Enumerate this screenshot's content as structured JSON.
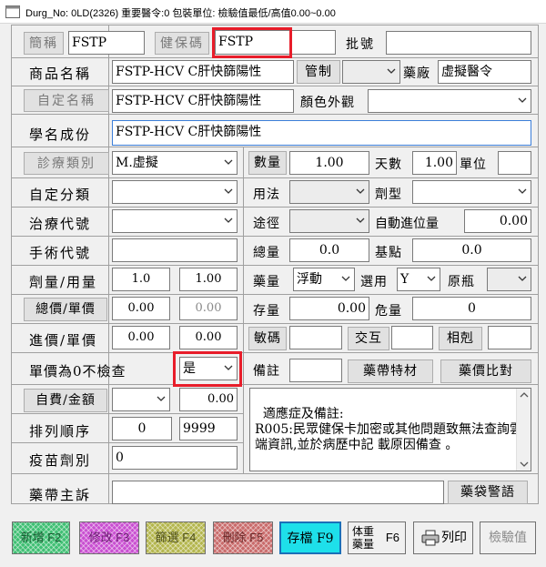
{
  "window": {
    "title": "Durg_No: 0LD(2326) 重要醫令:0 包裝單位: 檢驗值最低/高值0.00~0.00"
  },
  "fields": {
    "short_name_label": "簡稱",
    "short_name": "FSTP",
    "nhi_code_label": "健保碼",
    "nhi_code": "FSTP",
    "batch_label": "批號",
    "batch": "",
    "product_name_label": "商品名稱",
    "product_name": "FSTP-HCV C肝快篩陽性",
    "control_label": "管制",
    "control": "",
    "manufacturer_label": "藥廠",
    "manufacturer": "虛擬醫令",
    "custom_name_label": "自定名稱",
    "custom_name": "FSTP-HCV C肝快篩陽性",
    "appearance_label": "顏色外觀",
    "appearance": "",
    "generic_label": "學名成份",
    "generic": "FSTP-HCV C肝快篩陽性",
    "category_label": "診療類別",
    "category": "M.虛擬",
    "qty_label": "數量",
    "qty": "1.00",
    "days_label": "天數",
    "days": "1.00",
    "unit_label": "單位",
    "unit": "",
    "custom_class_label": "自定分類",
    "custom_class": "",
    "usage_label": "用法",
    "usage": "",
    "dosage_form_label": "劑型",
    "dosage_form": "",
    "treatment_code_label": "治療代號",
    "treatment_code": "",
    "route_label": "途徑",
    "route": "",
    "auto_round_label": "自動進位量",
    "auto_round": "0.00",
    "surgery_code_label": "手術代號",
    "surgery_code": "",
    "total_qty_label": "總量",
    "total_qty": "0.0",
    "base_point_label": "基點",
    "base_point": "0.0",
    "dose_label": "劑量/用量",
    "dose": "1.0",
    "dose2": "1.00",
    "bag_label": "藥量",
    "bag_type": "浮動",
    "option_label": "選用",
    "option": "Y",
    "original_label": "原瓶",
    "original": "",
    "price_label": "總價/單價",
    "total_price": "0.00",
    "unit_price": "0.00",
    "stock_label": "存量",
    "stock": "0.00",
    "danger_label": "危量",
    "danger": "0",
    "purchase_label": "進價/單價",
    "purchase_total": "0.00",
    "purchase_unit": "0.00",
    "allergy_label": "敏碼",
    "allergy": "",
    "interact_label": "交互",
    "interact": "",
    "conflict_label": "相剋",
    "conflict": "",
    "zero_check_label": "單價為0不檢查",
    "zero_check": "是",
    "note_label": "備註",
    "note": "",
    "carrier_btn": "藥帶特材",
    "compare_btn": "藥價比對",
    "selfpay_label": "自費/金額",
    "selfpay": "",
    "selfpay_amount": "0.00",
    "order_label": "排列順序",
    "order1": "0",
    "order2": "9999",
    "vaccine_label": "疫苗劑別",
    "vaccine": "0",
    "indication": "適應症及備註:\nR005:民眾健保卡加密或其他問題致無法查詢雲端資訊,並於病歷中記 載原因備查 。",
    "complaint_label": "藥帶主訴",
    "complaint": "",
    "warning_btn": "藥袋警語"
  },
  "footer": {
    "f2": "新增 F2",
    "f3": "修改 F3",
    "f4": "篩選 F4",
    "f5": "刪除 F5",
    "f9": "存檔 F9",
    "f6_top": "体重",
    "f6_bottom": "藥量",
    "f6_key": "F6",
    "print": "列印",
    "lab": "檢驗值"
  },
  "colors": {
    "highlight": "#e81d2a",
    "f2": "#3fbf73",
    "f3": "#c94fd1",
    "f4": "#b4b64e",
    "f5": "#c96b6b",
    "f9": "#1ee0ea"
  }
}
